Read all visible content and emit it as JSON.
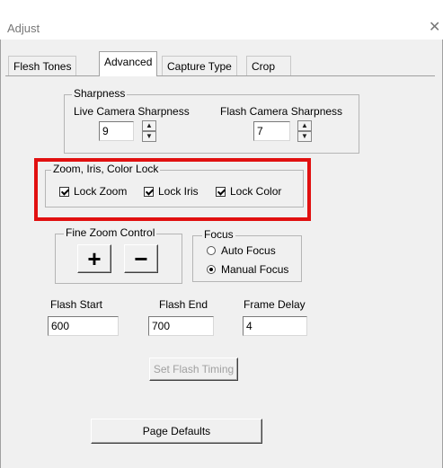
{
  "window": {
    "title": "Adjust",
    "close_icon": "close-icon"
  },
  "tabs": [
    {
      "label": "Flesh Tones",
      "active": false
    },
    {
      "label": "Advanced",
      "active": true
    },
    {
      "label": "Capture Type",
      "active": false
    },
    {
      "label": "Crop",
      "active": false
    }
  ],
  "sharpness": {
    "group_label": "Sharpness",
    "live_label": "Live Camera Sharpness",
    "live_value": "9",
    "flash_label": "Flash Camera Sharpness",
    "flash_value": "7"
  },
  "lock_group": {
    "label": "Zoom, Iris, Color Lock",
    "lock_zoom": {
      "label": "Lock Zoom",
      "checked": true
    },
    "lock_iris": {
      "label": "Lock Iris",
      "checked": true
    },
    "lock_color": {
      "label": "Lock Color",
      "checked": true
    },
    "highlight_color": "#e11010"
  },
  "fine_zoom": {
    "label": "Fine Zoom Control",
    "plus": "+",
    "minus": "−"
  },
  "focus": {
    "label": "Focus",
    "auto": {
      "label": "Auto Focus",
      "selected": false
    },
    "manual": {
      "label": "Manual Focus",
      "selected": true
    }
  },
  "timing": {
    "flash_start_label": "Flash Start",
    "flash_start_value": "600",
    "flash_end_label": "Flash End",
    "flash_end_value": "700",
    "frame_delay_label": "Frame Delay",
    "frame_delay_value": "4",
    "set_button": "Set Flash Timing"
  },
  "page_defaults_button": "Page Defaults"
}
